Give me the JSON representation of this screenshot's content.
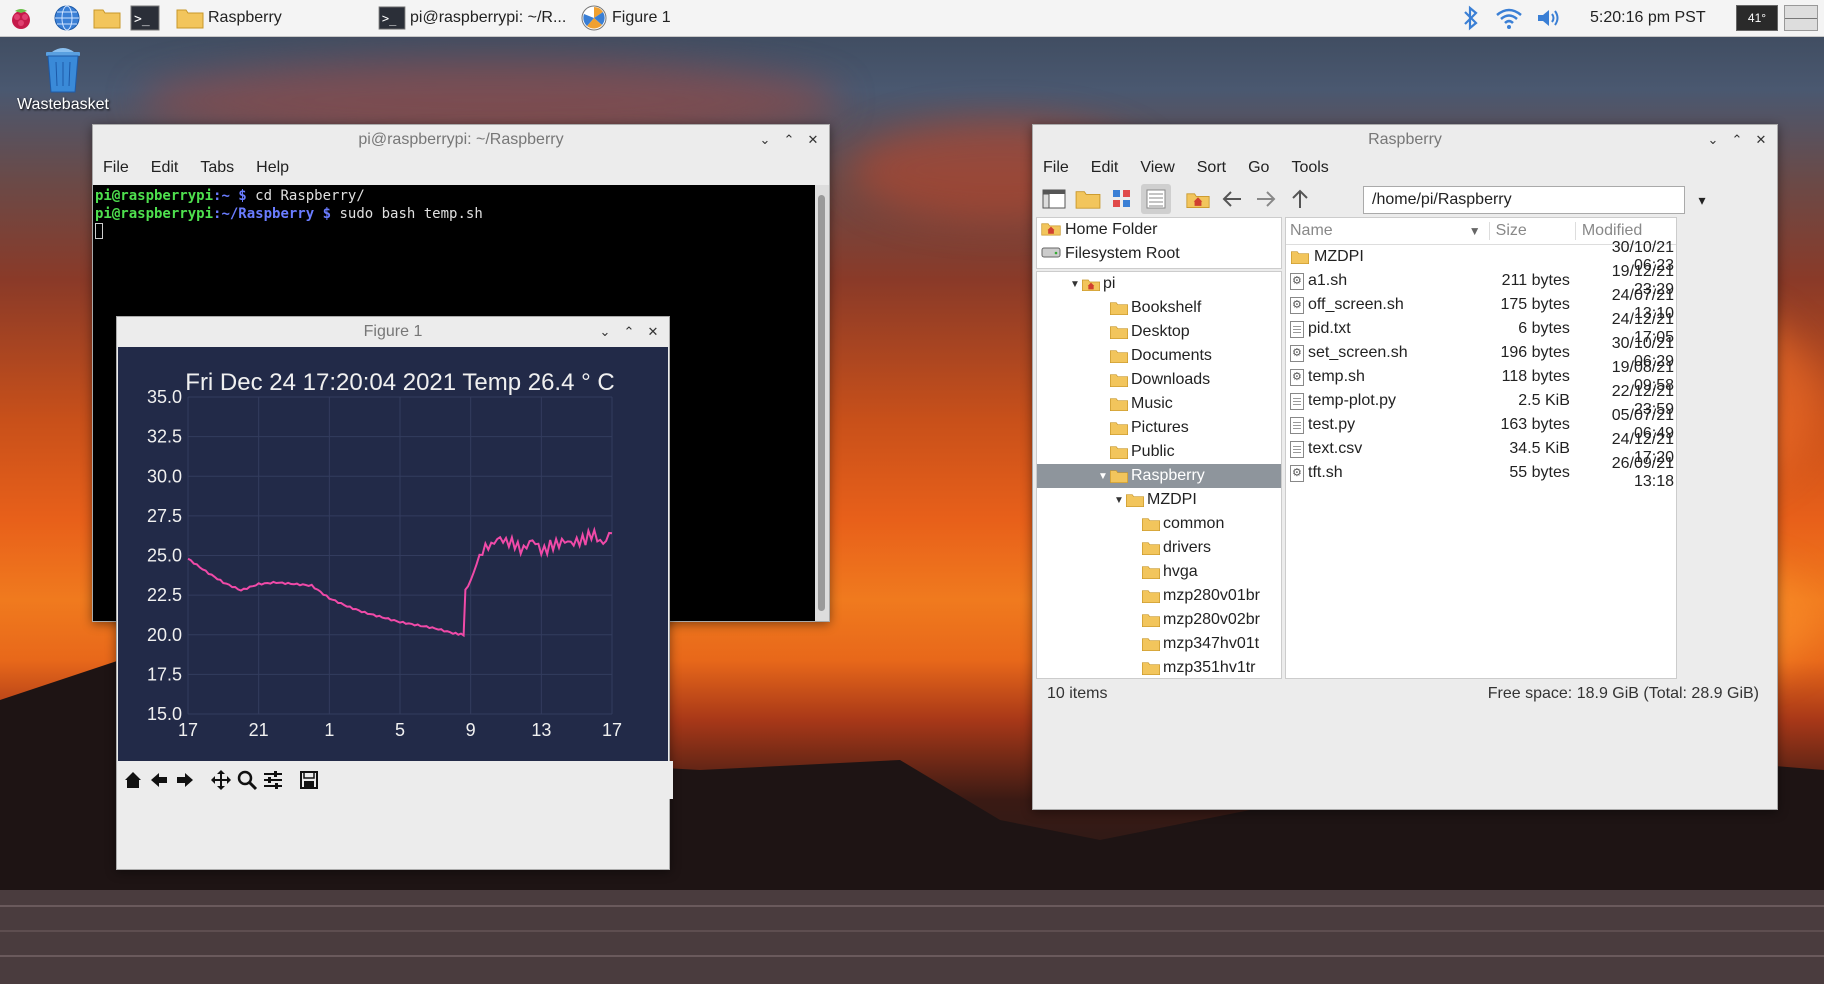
{
  "taskbar": {
    "folder_button_label": "Raspberry",
    "terminal_button_label": "pi@raspberrypi: ~/R...",
    "figure_button_label": "Figure 1",
    "clock": "5:20:16 pm PST",
    "cpu_temp": "41°"
  },
  "desktop": {
    "wastebasket_label": "Wastebasket"
  },
  "terminal": {
    "title": "pi@raspberrypi: ~/Raspberry",
    "menu": [
      "File",
      "Edit",
      "Tabs",
      "Help"
    ],
    "lines": [
      {
        "user": "pi@raspberrypi",
        "path": ":~",
        "prompt": " $ ",
        "cmd": "cd Raspberry/"
      },
      {
        "user": "pi@raspberrypi",
        "path": ":~/Raspberry",
        "prompt": " $ ",
        "cmd": "sudo bash temp.sh"
      }
    ]
  },
  "figure": {
    "title": "Figure 1"
  },
  "chart_data": {
    "type": "line",
    "title": "Fri Dec 24 17:20:04 2021 Temp 26.4 ° C",
    "xlabel": "",
    "ylabel": "",
    "x_ticks": [
      "17",
      "21",
      "1",
      "5",
      "9",
      "13",
      "17"
    ],
    "y_ticks": [
      "15.0",
      "17.5",
      "20.0",
      "22.5",
      "25.0",
      "27.5",
      "30.0",
      "32.5",
      "35.0"
    ],
    "ylim": [
      15.0,
      35.0
    ],
    "grid": true,
    "line_color": "#f04aa8",
    "background_color": "#222a48",
    "x": [
      17,
      18,
      19,
      20,
      20.5,
      21,
      22,
      23,
      24,
      25,
      26,
      27,
      28,
      29,
      30,
      31,
      32,
      32.6,
      32.7,
      33,
      33.5,
      34,
      34.5,
      35,
      35.5,
      36,
      36.5,
      37,
      37.5,
      38,
      38.5,
      39,
      39.5,
      40,
      40.5,
      41
    ],
    "values": [
      24.8,
      24.0,
      23.3,
      22.8,
      23.0,
      23.2,
      23.3,
      23.2,
      23.1,
      22.3,
      21.8,
      21.4,
      21.1,
      20.8,
      20.6,
      20.4,
      20.1,
      20.0,
      22.8,
      23.4,
      25.0,
      25.8,
      26.1,
      25.6,
      25.9,
      25.5,
      25.7,
      25.4,
      25.8,
      25.5,
      25.9,
      26.1,
      25.8,
      26.3,
      26.0,
      26.4
    ]
  },
  "filemanager": {
    "title": "Raspberry",
    "menu": [
      "File",
      "Edit",
      "View",
      "Sort",
      "Go",
      "Tools"
    ],
    "path": "/home/pi/Raspberry",
    "places": [
      {
        "label": "Home Folder",
        "icon": "home-icon"
      },
      {
        "label": "Filesystem Root",
        "icon": "drive-icon"
      }
    ],
    "tree": [
      {
        "label": "pi",
        "level": 0,
        "expanded": true,
        "icon": "home"
      },
      {
        "label": "Bookshelf",
        "level": 1,
        "icon": "folder"
      },
      {
        "label": "Desktop",
        "level": 1,
        "icon": "folder"
      },
      {
        "label": "Documents",
        "level": 1,
        "icon": "folder"
      },
      {
        "label": "Downloads",
        "level": 1,
        "icon": "folder"
      },
      {
        "label": "Music",
        "level": 1,
        "icon": "folder"
      },
      {
        "label": "Pictures",
        "level": 1,
        "icon": "folder"
      },
      {
        "label": "Public",
        "level": 1,
        "icon": "folder"
      },
      {
        "label": "Raspberry",
        "level": 1,
        "expanded": true,
        "selected": true,
        "icon": "folder"
      },
      {
        "label": "MZDPI",
        "level": 2,
        "expanded": true,
        "icon": "folder"
      },
      {
        "label": "common",
        "level": 3,
        "icon": "folder"
      },
      {
        "label": "drivers",
        "level": 3,
        "icon": "folder"
      },
      {
        "label": "hvga",
        "level": 3,
        "icon": "folder"
      },
      {
        "label": "mzp280v01br",
        "level": 3,
        "icon": "folder"
      },
      {
        "label": "mzp280v02br",
        "level": 3,
        "icon": "folder"
      },
      {
        "label": "mzp347hv01t",
        "level": 3,
        "icon": "folder"
      },
      {
        "label": "mzp351hv1tr",
        "level": 3,
        "icon": "folder"
      }
    ],
    "columns": {
      "name": "Name",
      "size": "Size",
      "modified": "Modified"
    },
    "files": [
      {
        "name": "MZDPI",
        "size": "",
        "modified": "30/10/21 06:23",
        "kind": "folder"
      },
      {
        "name": "a1.sh",
        "size": "211 bytes",
        "modified": "19/12/21 23:29",
        "kind": "script"
      },
      {
        "name": "off_screen.sh",
        "size": "175 bytes",
        "modified": "24/07/21 13:10",
        "kind": "script"
      },
      {
        "name": "pid.txt",
        "size": "6 bytes",
        "modified": "24/12/21 17:05",
        "kind": "text"
      },
      {
        "name": "set_screen.sh",
        "size": "196 bytes",
        "modified": "30/10/21 06:29",
        "kind": "script"
      },
      {
        "name": "temp.sh",
        "size": "118 bytes",
        "modified": "19/08/21 09:58",
        "kind": "script"
      },
      {
        "name": "temp-plot.py",
        "size": "2.5 KiB",
        "modified": "22/12/21 23:59",
        "kind": "text"
      },
      {
        "name": "test.py",
        "size": "163 bytes",
        "modified": "05/07/21 06:49",
        "kind": "text"
      },
      {
        "name": "text.csv",
        "size": "34.5 KiB",
        "modified": "24/12/21 17:20",
        "kind": "text"
      },
      {
        "name": "tft.sh",
        "size": "55 bytes",
        "modified": "26/09/21 13:18",
        "kind": "script"
      }
    ],
    "status_left": "10 items",
    "status_right": "Free space: 18.9 GiB (Total: 28.9 GiB)"
  }
}
